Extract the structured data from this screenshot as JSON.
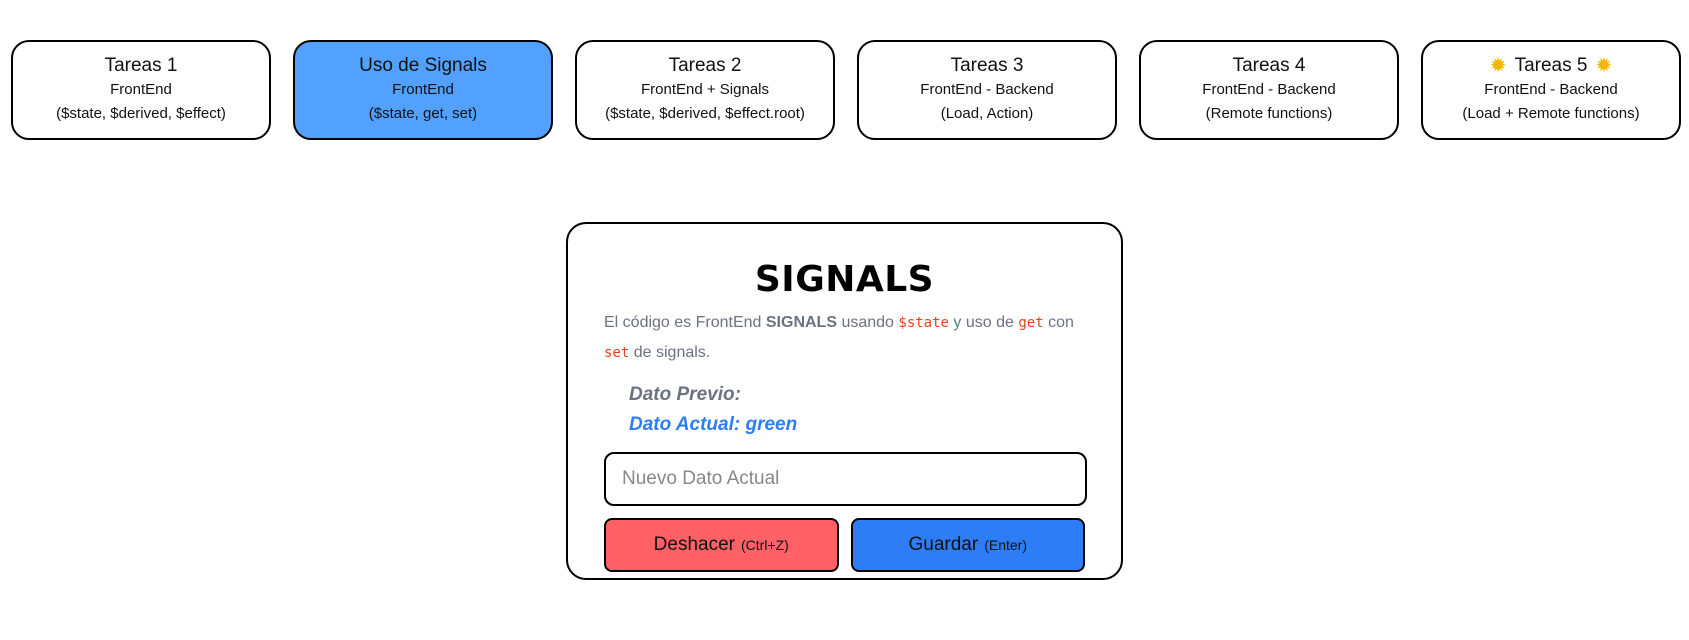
{
  "nav": {
    "items": [
      {
        "title": "Tareas 1",
        "sub1": "FrontEnd",
        "sub2": "($state, $derived, $effect)"
      },
      {
        "title": "Uso de Signals",
        "sub1": "FrontEnd",
        "sub2": "($state, get, set)",
        "active": true
      },
      {
        "title": "Tareas 2",
        "sub1": "FrontEnd + Signals",
        "sub2": "($state, $derived, $effect.root)"
      },
      {
        "title": "Tareas 3",
        "sub1": "FrontEnd - Backend",
        "sub2": "(Load, Action)"
      },
      {
        "title": "Tareas 4",
        "sub1": "FrontEnd - Backend",
        "sub2": "(Remote functions)"
      },
      {
        "title": "Tareas 5",
        "sub1": "FrontEnd - Backend",
        "sub2": "(Load + Remote functions)",
        "icon": "sun-icon"
      }
    ]
  },
  "main": {
    "title": "SIGNALS",
    "description": {
      "p1": "El código es FrontEnd ",
      "strong": "SIGNALS",
      "p2": " usando ",
      "code1": "$state",
      "p3": " y uso de ",
      "code2": "get",
      "p4": " con ",
      "code3": "set",
      "p5": " de signals."
    },
    "dato_previo": "Dato Previo:",
    "dato_actual": "Dato Actual: green",
    "input": {
      "placeholder": "Nuevo Dato Actual",
      "value": ""
    },
    "undo_button": {
      "label": "Deshacer",
      "shortcut": "(Ctrl+Z)"
    },
    "save_button": {
      "label": "Guardar",
      "shortcut": "(Enter)"
    }
  },
  "colors": {
    "active_tab": "#52a0ff",
    "undo": "#ff6166",
    "save": "#2f7df6",
    "code": "#e8421c",
    "dato_actual": "#2f7df6"
  }
}
